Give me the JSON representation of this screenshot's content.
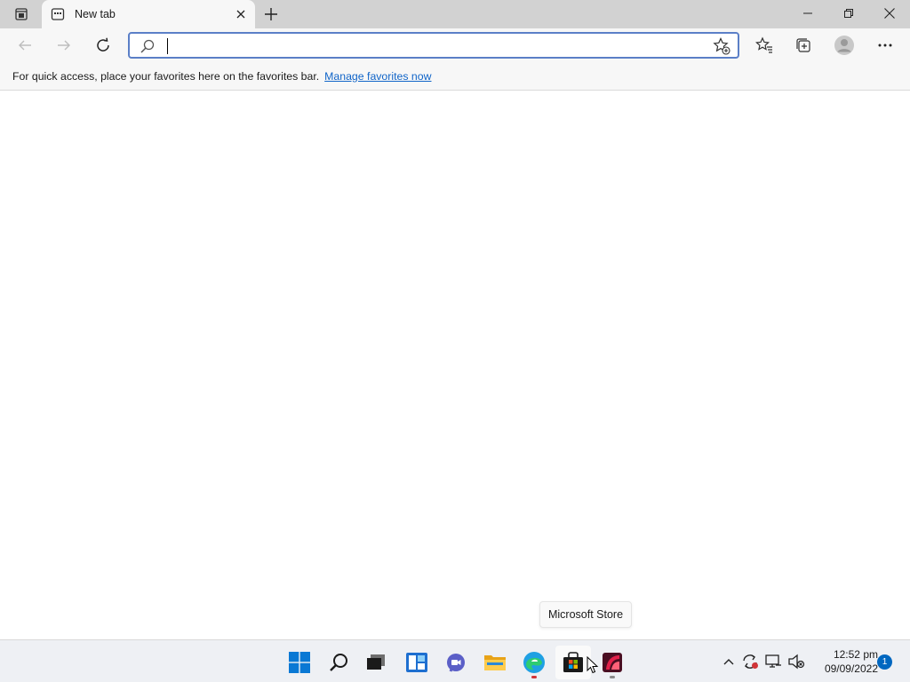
{
  "window": {
    "tab": {
      "title": "New tab"
    },
    "tab_actions_icon": "tab-actions-icon",
    "controls": [
      "minimize",
      "restore",
      "close"
    ]
  },
  "toolbar": {
    "address": {
      "value": "",
      "placeholder": ""
    },
    "buttons": [
      "back",
      "forward",
      "refresh",
      "favorites",
      "collections",
      "profile",
      "settings-and-more"
    ]
  },
  "favorites_bar": {
    "message": "For quick access, place your favorites here on the favorites bar.",
    "link": "Manage favorites now"
  },
  "tooltip": {
    "text": "Microsoft Store"
  },
  "taskbar": {
    "apps": [
      "start",
      "search",
      "task-view",
      "widgets",
      "chat",
      "file-explorer",
      "edge",
      "microsoft-store",
      "app"
    ],
    "clock": {
      "time": "12:52 pm",
      "date": "09/09/2022"
    },
    "notification_count": "1"
  },
  "colors": {
    "accent": "#0067c0",
    "link": "#1064c8",
    "address_focus": "#5b7fc7",
    "recording_dot": "#d13438"
  }
}
